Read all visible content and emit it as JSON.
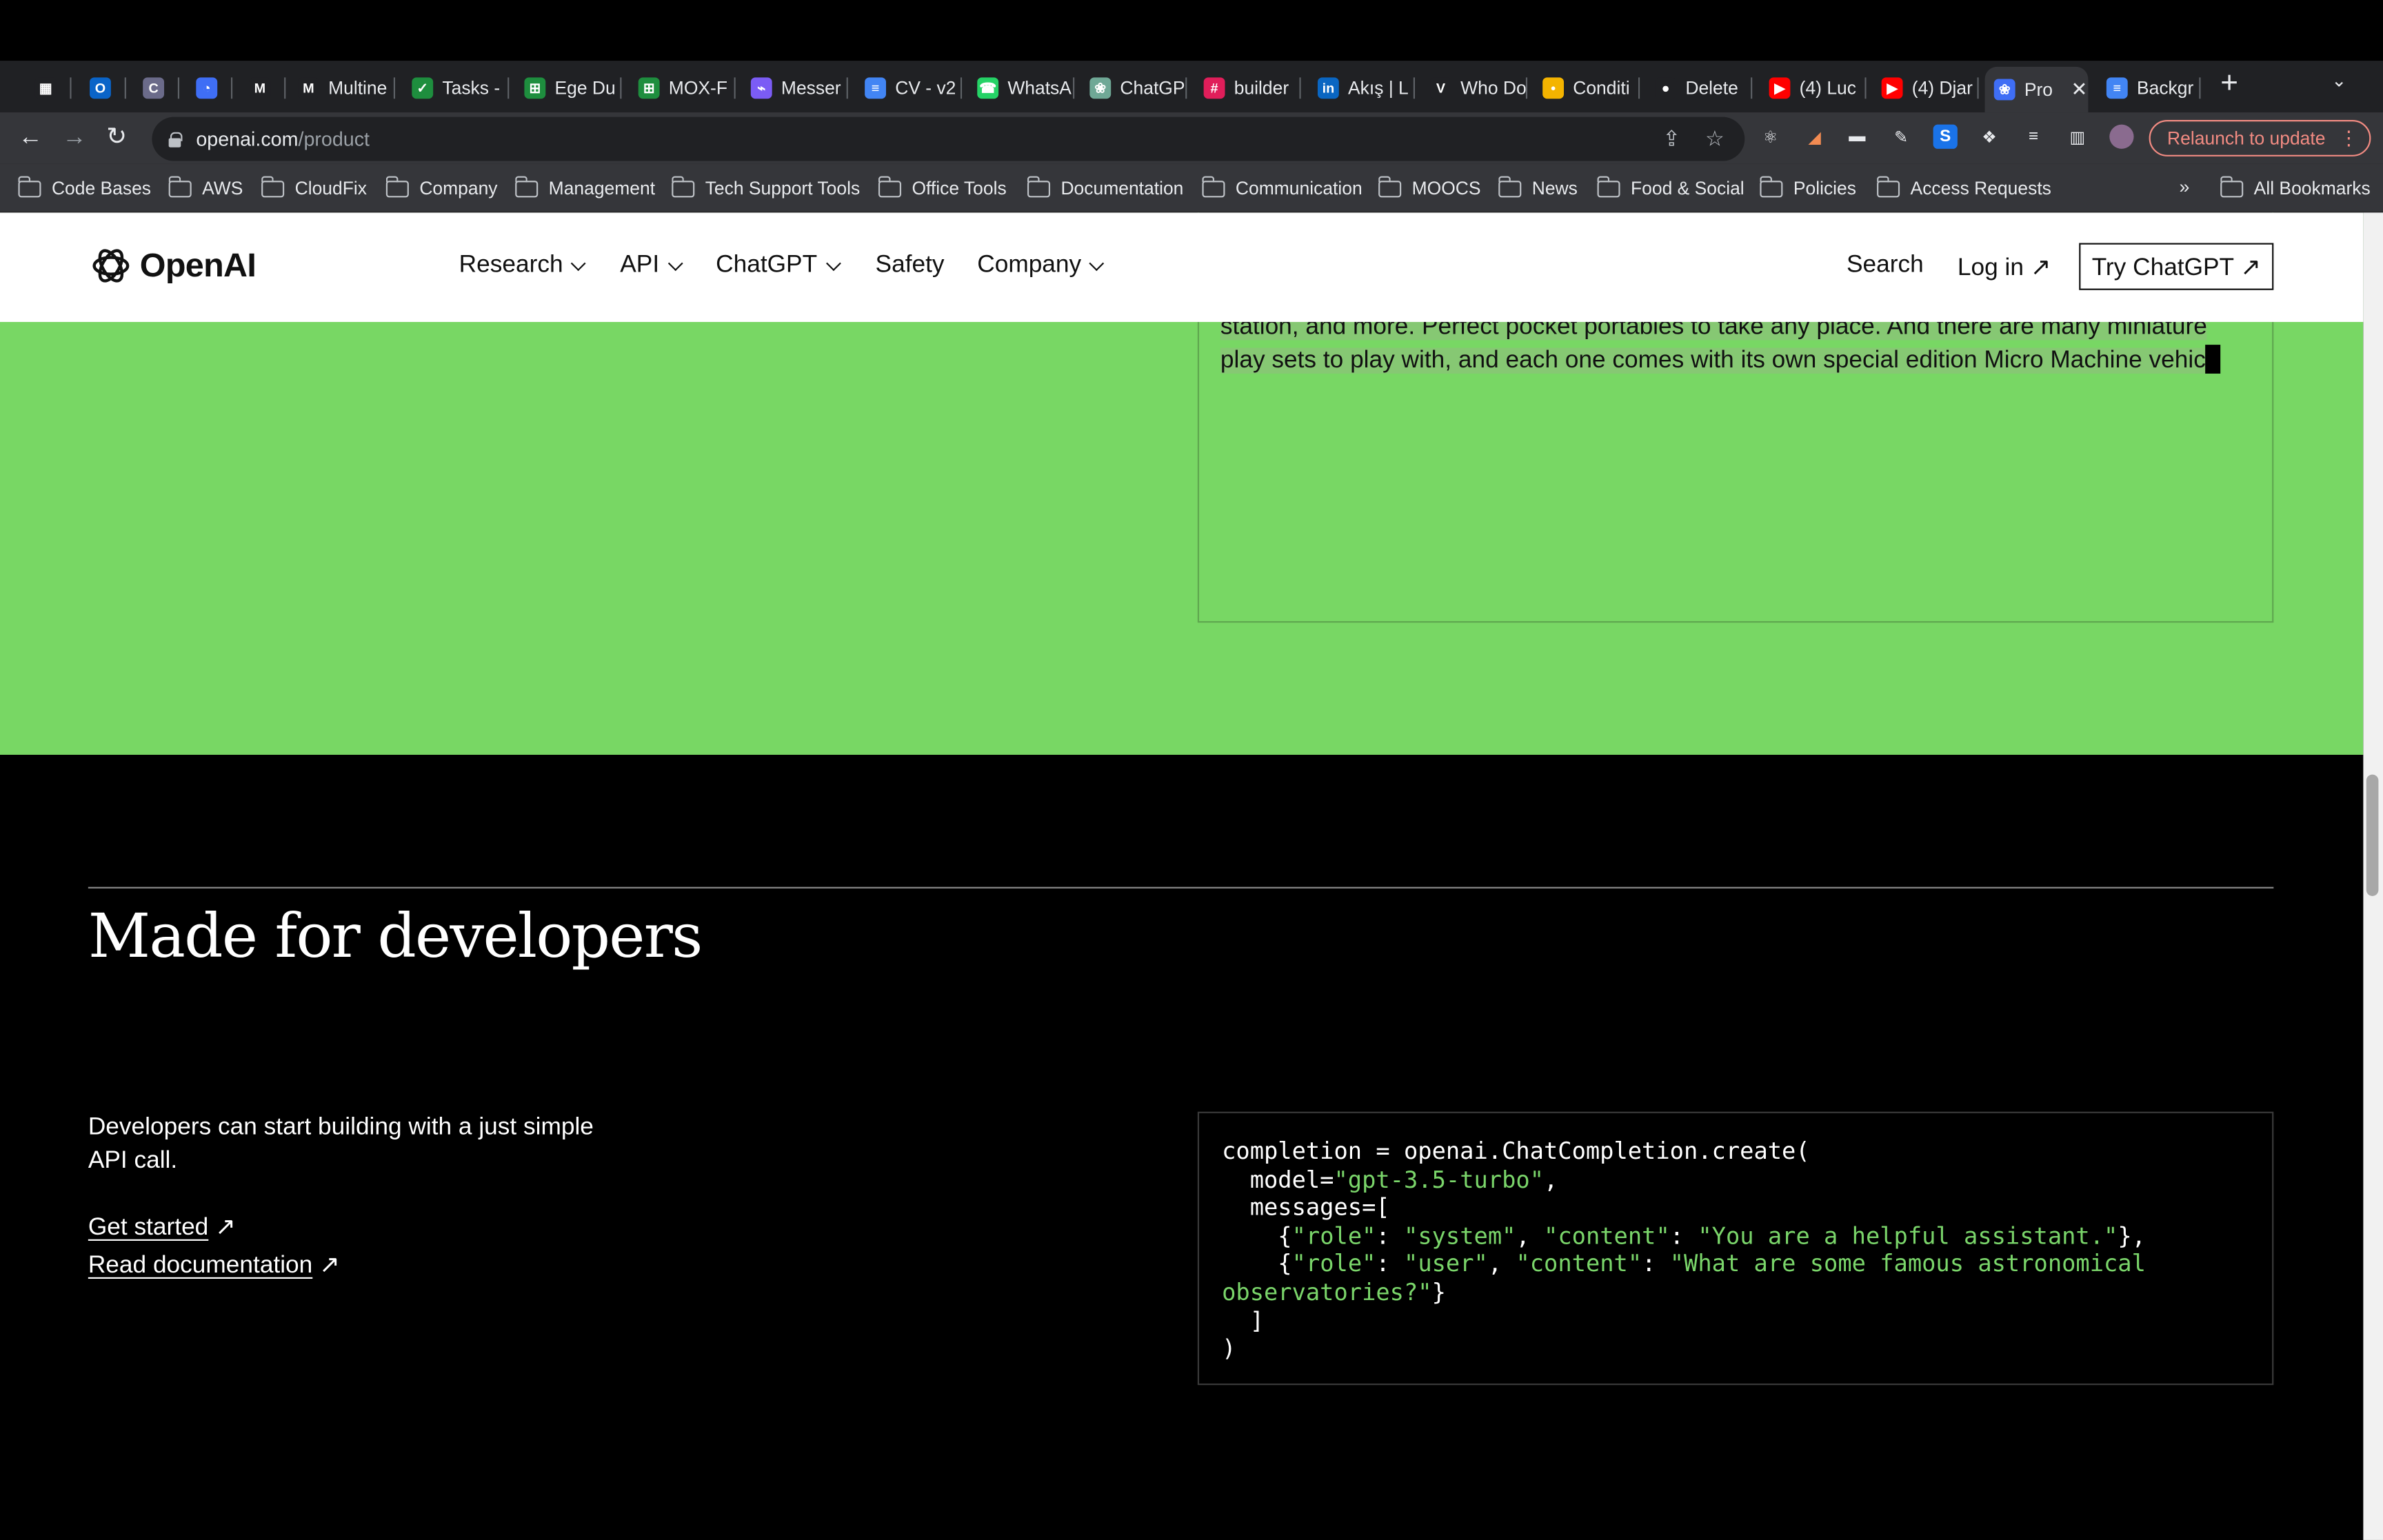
{
  "browser": {
    "tabs": [
      {
        "label": "",
        "icon": "apps-icon",
        "color": "#202124"
      },
      {
        "label": "",
        "icon": "outlook-icon",
        "color": "#0a64c8"
      },
      {
        "label": "",
        "icon": "c-icon",
        "color": "#6b6b8a"
      },
      {
        "label": "",
        "icon": "clockify-icon",
        "color": "#3f6ef5"
      },
      {
        "label": "",
        "icon": "gmail-icon",
        "color": "#202124"
      },
      {
        "label": "Multine",
        "icon": "gmail-icon",
        "color": "#202124"
      },
      {
        "label": "Tasks -",
        "icon": "tasks-icon",
        "color": "#1e8e3e"
      },
      {
        "label": "Ege Du",
        "icon": "sheets-icon",
        "color": "#1e8e3e"
      },
      {
        "label": "MOX-F",
        "icon": "sheets-icon",
        "color": "#1e8e3e"
      },
      {
        "label": "Messer",
        "icon": "messenger-icon",
        "color": "#7b5cf5"
      },
      {
        "label": "CV - v2",
        "icon": "docs-icon",
        "color": "#4285f4"
      },
      {
        "label": "WhatsA",
        "icon": "whatsapp-icon",
        "color": "#25d366"
      },
      {
        "label": "ChatGP",
        "icon": "chatgpt-icon",
        "color": "#6fa896"
      },
      {
        "label": "builder",
        "icon": "slack-icon",
        "color": "#e01e5a"
      },
      {
        "label": "Akış | L",
        "icon": "linkedin-icon",
        "color": "#0a66c2"
      },
      {
        "label": "Who Do",
        "icon": "v-icon",
        "color": "#202124"
      },
      {
        "label": "Conditi",
        "icon": "c2-icon",
        "color": "#f4b400"
      },
      {
        "label": "Delete",
        "icon": "github-icon",
        "color": "#202124"
      },
      {
        "label": "(4) Luc",
        "icon": "youtube-icon",
        "color": "#ff0000"
      },
      {
        "label": "(4) Djar",
        "icon": "youtube-icon",
        "color": "#ff0000"
      },
      {
        "label": "Pro",
        "icon": "openai-icon",
        "color": "#3f6ef5",
        "active": true
      },
      {
        "label": "Backgr",
        "icon": "docs-icon",
        "color": "#4285f4"
      }
    ],
    "url_host": "openai.com",
    "url_path": "/product",
    "relaunch_label": "Relaunch to update",
    "bookmarks": [
      "Code Bases",
      "AWS",
      "CloudFix",
      "Company",
      "Management",
      "Tech Support Tools",
      "Office Tools",
      "Documentation",
      "Communication",
      "MOOCS",
      "News",
      "Food & Social",
      "Policies",
      "Access Requests"
    ],
    "bookmarks_more": "»",
    "all_bookmarks": "All Bookmarks"
  },
  "site": {
    "logo": "OpenAI",
    "nav": [
      "Research",
      "API",
      "ChatGPT",
      "Safety",
      "Company"
    ],
    "search": "Search",
    "login": "Log in ↗",
    "try_chatgpt": "Try ChatGPT ↗"
  },
  "demo": {
    "line1": "station, and more. Perfect pocket portables to take any place. And there are many miniature",
    "line2": "play sets to play with, and each one comes with its own special edition Micro Machine vehic"
  },
  "developers": {
    "title": "Made for developers",
    "description": "Developers can start building with a just simple API call.",
    "get_started": "Get started",
    "read_docs": "Read documentation",
    "arrow": "↗",
    "code": {
      "l1": "completion = openai.ChatCompletion.create(",
      "l2a": "  model=",
      "l2s": "\"gpt-3.5-turbo\"",
      "l2b": ",",
      "l3": "  messages=[",
      "l4a": "    {",
      "l4s1": "\"role\"",
      "l4b": ": ",
      "l4s2": "\"system\"",
      "l4c": ", ",
      "l4s3": "\"content\"",
      "l4d": ": ",
      "l4s4": "\"You are a helpful assistant.\"",
      "l4e": "},",
      "l5a": "    {",
      "l5s1": "\"role\"",
      "l5b": ": ",
      "l5s2": "\"user\"",
      "l5c": ", ",
      "l5s3": "\"content\"",
      "l5d": ": ",
      "l5s4": "\"What are some famous astronomical",
      "l6s": "observatories?\"",
      "l6b": "}",
      "l7": "  ]",
      "l8": ")"
    }
  },
  "colors": {
    "page_green": "#78d764",
    "code_string": "#7ad56a",
    "relaunch": "#f28b82"
  }
}
